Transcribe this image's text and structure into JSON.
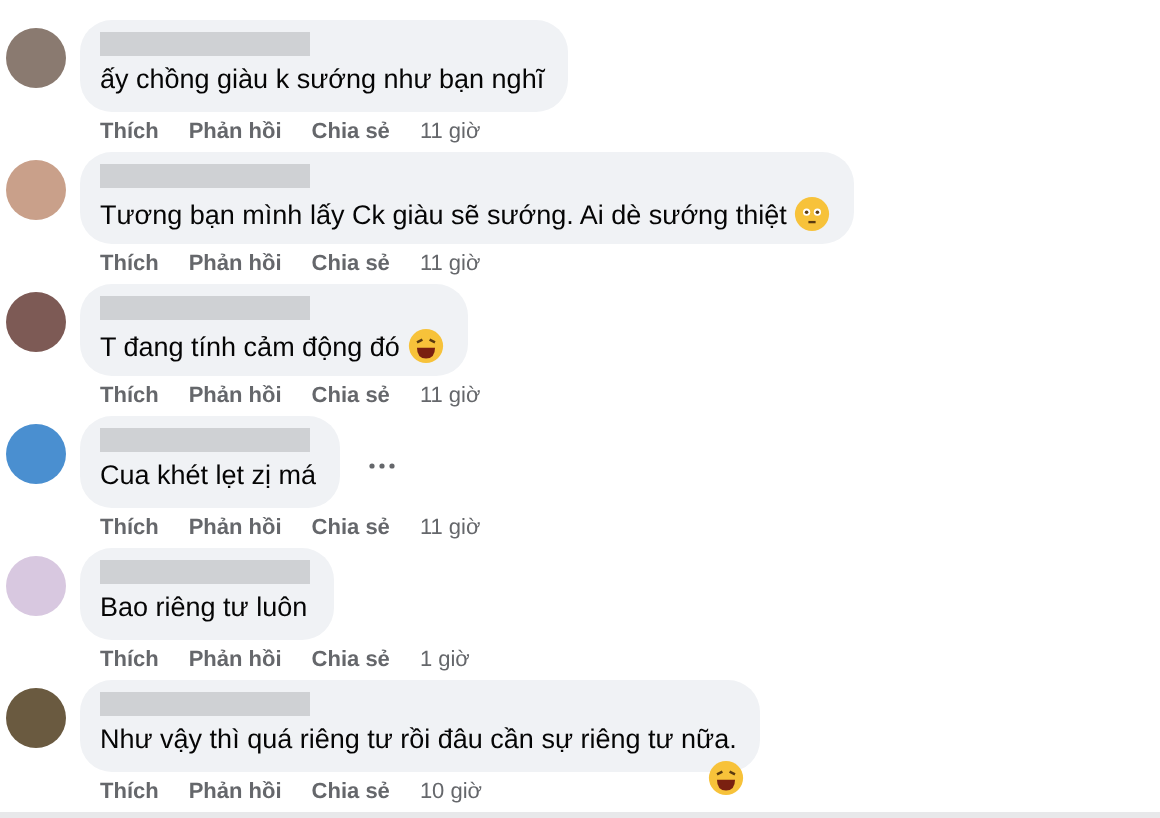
{
  "comments": [
    {
      "kind": "plain",
      "text": "ấy chồng giàu k sướng như bạn nghĩ",
      "more_button": false,
      "actions": {
        "like": "Thích",
        "reply": "Phản hồi",
        "share": "Chia sẻ",
        "time": "11 giờ"
      }
    },
    {
      "kind": "flushed",
      "text": "Tương bạn mình lấy Ck giàu sẽ sướng. Ai dè sướng thiệt",
      "more_button": false,
      "actions": {
        "like": "Thích",
        "reply": "Phản hồi",
        "share": "Chia sẻ",
        "time": "11 giờ"
      }
    },
    {
      "kind": "laughing",
      "text": "T đang tính cảm động đó",
      "more_button": false,
      "actions": {
        "like": "Thích",
        "reply": "Phản hồi",
        "share": "Chia sẻ",
        "time": "11 giờ"
      }
    },
    {
      "kind": "plain",
      "text": "Cua khét lẹt zị má",
      "more_button": true,
      "actions": {
        "like": "Thích",
        "reply": "Phản hồi",
        "share": "Chia sẻ",
        "time": "11 giờ"
      }
    },
    {
      "kind": "plain",
      "text": "Bao riêng tư luôn",
      "more_button": false,
      "actions": {
        "like": "Thích",
        "reply": "Phản hồi",
        "share": "Chia sẻ",
        "time": "1 giờ"
      }
    },
    {
      "kind": "laughing",
      "text": "Như vậy thì quá riêng tư rồi đâu cần sự riêng tư nữa.",
      "more_button": false,
      "actions": {
        "like": "Thích",
        "reply": "Phản hồi",
        "share": "Chia sẻ",
        "time": "10 giờ"
      }
    }
  ]
}
